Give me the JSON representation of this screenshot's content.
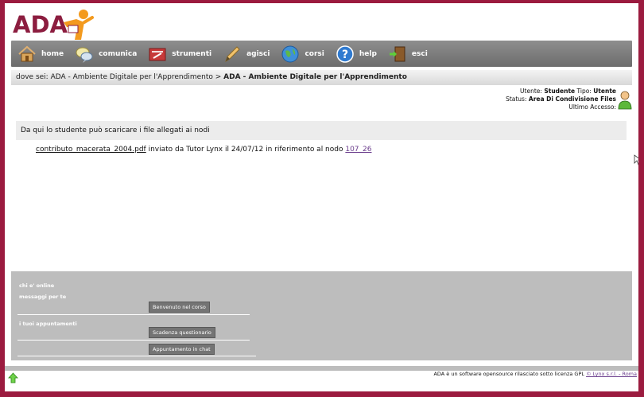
{
  "logo": {
    "text": "ADA"
  },
  "nav": [
    {
      "label": "home",
      "icon": "home-icon"
    },
    {
      "label": "comunica",
      "icon": "chat-bubble-icon"
    },
    {
      "label": "strumenti",
      "icon": "tools-icon"
    },
    {
      "label": "agisci",
      "icon": "pencil-icon"
    },
    {
      "label": "corsi",
      "icon": "globe-icon"
    },
    {
      "label": "help",
      "icon": "help-icon"
    },
    {
      "label": "esci",
      "icon": "exit-door-icon"
    }
  ],
  "breadcrumb": {
    "prefix": "dove sei: ADA - Ambiente Digitale per l'Apprendimento > ",
    "current": "ADA - Ambiente Digitale per l'Apprendimento"
  },
  "user": {
    "utente_label": "Utente:",
    "utente_value": "Studente",
    "tipo_label": "Tipo:",
    "tipo_value": "Utente",
    "status_label": "Status:",
    "status_value": "Area Di Condivisione Files",
    "ultimo_label": "Ultimo Accesso:"
  },
  "content": {
    "header": "Da qui lo studente può scaricare i file allegati ai nodi",
    "file_name": "contributo_macerata_2004.pdf",
    "file_desc": " inviato da Tutor Lynx il 24/07/12 in riferimento al nodo ",
    "node_link": "107_26"
  },
  "bottom": {
    "online_label": "chi e' online",
    "messages_label": "messaggi per te",
    "message_button": "Benvenuto nel corso",
    "appointments_label": "i tuoi appuntamenti",
    "appt_button_1": "Scadenza questionario",
    "appt_button_2": "Appuntamento in chat"
  },
  "footer": {
    "text": "ADA è un software opensource rilasciato sotto licenza GPL ",
    "link": "© Lynx s.r.l. - Roma"
  },
  "colors": {
    "brand": "#8c1d3f",
    "frame": "#9b1b3f",
    "nav": "#7a7a7a",
    "panel": "#bdbdbd"
  }
}
